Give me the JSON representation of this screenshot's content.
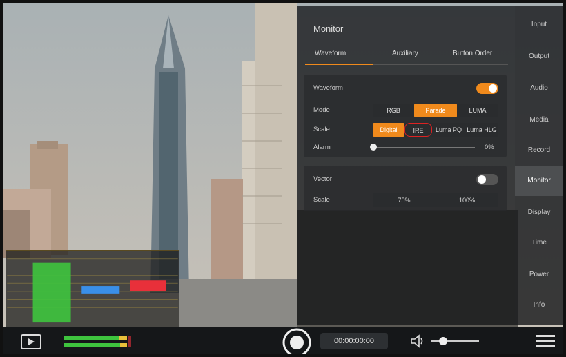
{
  "panel": {
    "title": "Monitor",
    "tabs": [
      {
        "label": "Waveform",
        "active": true
      },
      {
        "label": "Auxiliary",
        "active": false
      },
      {
        "label": "Button Order",
        "active": false
      }
    ],
    "waveform_section": {
      "label": "Waveform",
      "enabled": true,
      "mode": {
        "label": "Mode",
        "options": [
          "RGB",
          "Parade",
          "LUMA"
        ],
        "selected": "Parade"
      },
      "scale": {
        "label": "Scale",
        "options": [
          "Digital",
          "IRE",
          "Luma PQ",
          "Luma HLG"
        ],
        "selected": "Digital"
      },
      "alarm": {
        "label": "Alarm",
        "value": "0%",
        "level": 0
      }
    },
    "vector_section": {
      "label": "Vector",
      "enabled": false,
      "scale": {
        "label": "Scale",
        "options": [
          "75%",
          "100%"
        ]
      }
    }
  },
  "sidenav": {
    "items": [
      {
        "label": "Input",
        "active": false
      },
      {
        "label": "Output",
        "active": false
      },
      {
        "label": "Audio",
        "active": false
      },
      {
        "label": "Media",
        "active": false
      },
      {
        "label": "Record",
        "active": false
      },
      {
        "label": "Monitor",
        "active": true
      },
      {
        "label": "Display",
        "active": false
      },
      {
        "label": "Time",
        "active": false
      },
      {
        "label": "Power",
        "active": false
      },
      {
        "label": "Info",
        "active": false
      }
    ]
  },
  "bottombar": {
    "timecode": "00:00:00:00",
    "volume_level": 0.15,
    "icons": [
      "play-icon",
      "record-icon",
      "speaker-icon",
      "menu-icon"
    ]
  },
  "colors": {
    "accent": "#f08a1c",
    "panel_bg": "#16181a",
    "waveform_green": "#3ec43e",
    "waveform_blue": "#3a8fe8",
    "waveform_red": "#e8303a"
  }
}
